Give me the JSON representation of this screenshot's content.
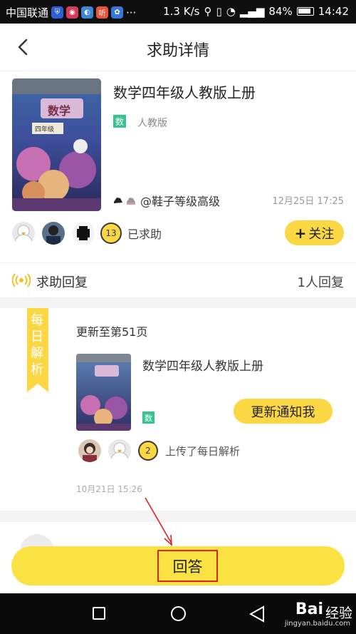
{
  "status_bar": {
    "carrier": "中国联通",
    "network_speed": "1.3 K/s",
    "battery": "84%",
    "time": "14:42",
    "app_icons": [
      {
        "name": "shield-app-icon",
        "color": "#2e5fd8"
      },
      {
        "name": "photo-app-icon",
        "color": "#d83b5a"
      },
      {
        "name": "sim-app-icon",
        "color": "#3c87d8"
      },
      {
        "name": "ting-app-icon",
        "color": "#e8553a",
        "glyph": "听"
      },
      {
        "name": "paw-app-icon",
        "color": "#3a76d8"
      }
    ]
  },
  "nav": {
    "title": "求助详情"
  },
  "question": {
    "book_title": "数学四年级人教版上册",
    "subject_tag": "数",
    "edition": "人教版",
    "username": "@鞋子等级高级",
    "time": "12月25日 17:25",
    "help_count": "13",
    "help_label": "已求助",
    "follow_label": "关注",
    "cover_title": "数学",
    "cover_sub": "四年级"
  },
  "reply": {
    "title": "求助回复",
    "count": "1人回复"
  },
  "daily": {
    "ribbon": [
      "每",
      "日",
      "解",
      "析"
    ],
    "update": "更新至第51页",
    "book_title": "数学四年级人教版上册",
    "subject_tag": "数",
    "notify_label": "更新通知我",
    "uploader_count": "2",
    "uploader_label": "上传了每日解析",
    "time": "10月21日 15:26"
  },
  "answer": {
    "label": "回答"
  },
  "watermark": {
    "brand": "Bai",
    "suffix": "经验",
    "url": "jingyan.baidu.com"
  },
  "colors": {
    "accent_yellow": "#fcd744",
    "tag_green": "#35c38f",
    "highlight_red": "#e02222"
  }
}
